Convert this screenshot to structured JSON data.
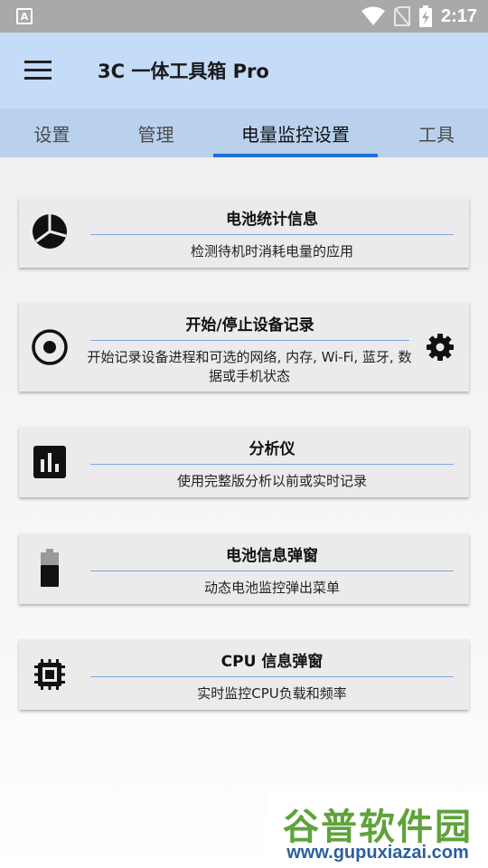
{
  "status_bar": {
    "time": "2:17",
    "notification_icon": "a-icon"
  },
  "app_bar": {
    "title": "3C 一体工具箱 Pro",
    "menu_icon": "hamburger-menu-icon"
  },
  "tabs": [
    {
      "label": "设置",
      "active": false
    },
    {
      "label": "管理",
      "active": false
    },
    {
      "label": "电量监控设置",
      "active": true
    },
    {
      "label": "工具",
      "active": false
    }
  ],
  "cards": [
    {
      "title": "电池统计信息",
      "description": "检测待机时消耗电量的应用",
      "icon": "pie-chart-icon"
    },
    {
      "title": "开始/停止设备记录",
      "description": "开始记录设备进程和可选的网络, 内存, Wi-Fi, 蓝牙, 数据或手机状态",
      "icon": "record-icon",
      "action_icon": "gear-icon"
    },
    {
      "title": "分析仪",
      "description": "使用完整版分析以前或实时记录",
      "icon": "bar-chart-icon"
    },
    {
      "title": "电池信息弹窗",
      "description": "动态电池监控弹出菜单",
      "icon": "battery-icon"
    },
    {
      "title": "CPU 信息弹窗",
      "description": "实时监控CPU负载和频率",
      "icon": "cpu-chip-icon"
    }
  ],
  "watermark": {
    "title": "谷普软件园",
    "url": "www.gupuxiazai.com"
  },
  "colors": {
    "app_bar": "#c4dcf8",
    "tab_bar": "#b9d1ed",
    "tab_indicator": "#1f6fd6",
    "card": "#ebebeb",
    "divider": "#7ea7dd"
  }
}
